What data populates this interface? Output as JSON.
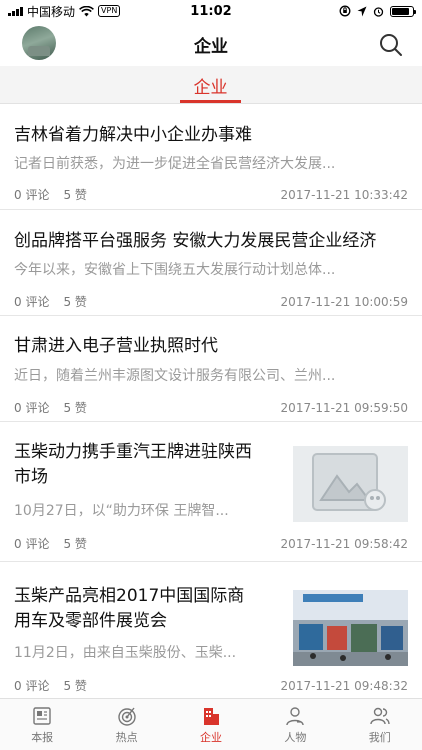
{
  "status": {
    "carrier": "中国移动",
    "vpn": "VPN",
    "time": "11:02",
    "battery_level": 0.85
  },
  "nav": {
    "title": "企业"
  },
  "category_tab": {
    "label": "企业"
  },
  "articles": [
    {
      "title": "吉林省着力解决中小企业办事难",
      "summary": "记者日前获悉，为进一步促进全省民营经济大发展...",
      "comments": "0 评论",
      "likes": "5 赞",
      "time": "2017-11-21 10:33:42"
    },
    {
      "title": "创品牌搭平台强服务 安徽大力发展民营企业经济",
      "summary": "今年以来，安徽省上下围绕五大发展行动计划总体...",
      "comments": "0 评论",
      "likes": "5 赞",
      "time": "2017-11-21 10:00:59"
    },
    {
      "title": "甘肃进入电子营业执照时代",
      "summary": "近日，随着兰州丰源图文设计服务有限公司、兰州...",
      "comments": "0 评论",
      "likes": "5 赞",
      "time": "2017-11-21 09:59:50"
    },
    {
      "title_line1": "玉柴动力携手重汽王牌进驻陕西",
      "title_line2": "市场",
      "summary": "10月27日，以“助力环保 王牌智...",
      "comments": "0 评论",
      "likes": "5 赞",
      "time": "2017-11-21 09:58:42",
      "image": "image-placeholder-icon"
    },
    {
      "title_line1": "玉柴产品亮相2017中国国际商",
      "title_line2": "用车及零部件展览会",
      "summary": "11月2日，由来自玉柴股份、玉柴...",
      "comments": "0 评论",
      "likes": "5 赞",
      "time": "2017-11-21 09:48:32",
      "image": "exhibition-photo"
    }
  ],
  "tabbar": [
    {
      "label": "本报",
      "icon": "newspaper-icon"
    },
    {
      "label": "热点",
      "icon": "target-icon"
    },
    {
      "label": "企业",
      "icon": "building-icon",
      "active": true
    },
    {
      "label": "人物",
      "icon": "person-card-icon"
    },
    {
      "label": "我们",
      "icon": "people-icon"
    }
  ],
  "colors": {
    "accent": "#d9342b",
    "tab_strip_bg": "#f4f4f4",
    "summary_text": "#9a9a9a"
  }
}
